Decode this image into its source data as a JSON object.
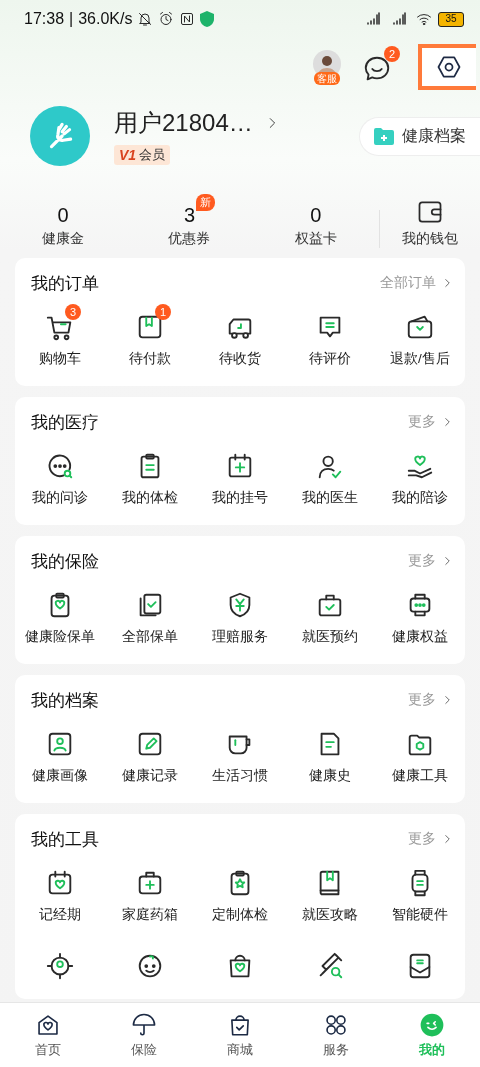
{
  "status_bar": {
    "time": "17:38",
    "separator": "|",
    "speed": "36.0K/s",
    "battery": "35"
  },
  "header": {
    "service_label": "客服",
    "message_badge": "2",
    "settings_highlighted": true
  },
  "profile": {
    "name": "用户21804…",
    "level": "V1",
    "level_label": "会员",
    "health_file": "健康档案"
  },
  "stats": [
    {
      "value": "0",
      "label": "健康金"
    },
    {
      "value": "3",
      "label": "优惠券",
      "badge": "新"
    },
    {
      "value": "0",
      "label": "权益卡"
    }
  ],
  "wallet": {
    "label": "我的钱包"
  },
  "sections": [
    {
      "title": "我的订单",
      "more": "全部订单",
      "items": [
        {
          "kind": "labeled",
          "label": "购物车",
          "badge": "3"
        },
        {
          "kind": "labeled",
          "label": "待付款",
          "badge": "1"
        },
        {
          "kind": "labeled",
          "label": "待收货"
        },
        {
          "kind": "labeled",
          "label": "待评价"
        },
        {
          "kind": "labeled",
          "label": "退款/售后"
        }
      ]
    },
    {
      "title": "我的医疗",
      "more": "更多",
      "items": [
        {
          "kind": "labeled",
          "label": "我的问诊"
        },
        {
          "kind": "labeled",
          "label": "我的体检"
        },
        {
          "kind": "labeled",
          "label": "我的挂号"
        },
        {
          "kind": "labeled",
          "label": "我的医生"
        },
        {
          "kind": "labeled",
          "label": "我的陪诊"
        }
      ]
    },
    {
      "title": "我的保险",
      "more": "更多",
      "items": [
        {
          "kind": "labeled",
          "label": "健康险保单"
        },
        {
          "kind": "labeled",
          "label": "全部保单"
        },
        {
          "kind": "labeled",
          "label": "理赔服务"
        },
        {
          "kind": "labeled",
          "label": "就医预约"
        },
        {
          "kind": "labeled",
          "label": "健康权益"
        }
      ]
    },
    {
      "title": "我的档案",
      "more": "更多",
      "items": [
        {
          "kind": "labeled",
          "label": "健康画像"
        },
        {
          "kind": "labeled",
          "label": "健康记录"
        },
        {
          "kind": "labeled",
          "label": "生活习惯"
        },
        {
          "kind": "labeled",
          "label": "健康史"
        },
        {
          "kind": "labeled",
          "label": "健康工具"
        }
      ]
    },
    {
      "title": "我的工具",
      "more": "更多",
      "items": [
        {
          "kind": "labeled",
          "label": "记经期"
        },
        {
          "kind": "labeled",
          "label": "家庭药箱"
        },
        {
          "kind": "labeled",
          "label": "定制体检"
        },
        {
          "kind": "labeled",
          "label": "就医攻略"
        },
        {
          "kind": "labeled",
          "label": "智能硬件"
        },
        {
          "kind": "icon_only"
        },
        {
          "kind": "icon_only"
        },
        {
          "kind": "icon_only"
        },
        {
          "kind": "icon_only"
        },
        {
          "kind": "icon_only"
        }
      ]
    }
  ],
  "tabs": [
    {
      "label": "首页",
      "selected": false
    },
    {
      "label": "保险",
      "selected": false
    },
    {
      "label": "商城",
      "selected": false
    },
    {
      "label": "服务",
      "selected": false
    },
    {
      "label": "我的",
      "selected": true
    }
  ]
}
